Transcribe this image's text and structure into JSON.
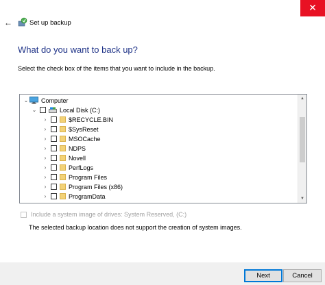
{
  "window": {
    "title": "Set up backup",
    "close_glyph": "✕",
    "back_glyph": "←"
  },
  "page": {
    "heading": "What do you want to back up?",
    "instruction": "Select the check box of the items that you want to include in the backup."
  },
  "tree": {
    "computer_label": "Computer",
    "disk_label": "Local Disk (C:)",
    "folders": [
      "$RECYCLE.BIN",
      "$SysReset",
      "MSOCache",
      "NDPS",
      "Novell",
      "PerfLogs",
      "Program Files",
      "Program Files (x86)",
      "ProgramData"
    ]
  },
  "system_image": {
    "label": "Include a system image of drives: System Reserved, (C:)",
    "note": "The selected backup location does not support the creation of system images."
  },
  "buttons": {
    "next": "Next",
    "cancel": "Cancel"
  },
  "icons": {
    "computer": "computer-icon",
    "disk": "disk-icon",
    "folder": "folder-icon",
    "app": "backup-app-icon"
  },
  "colors": {
    "heading": "#1e3287",
    "close": "#e81123",
    "focus": "#0078d7",
    "folder": "#f3d277"
  }
}
